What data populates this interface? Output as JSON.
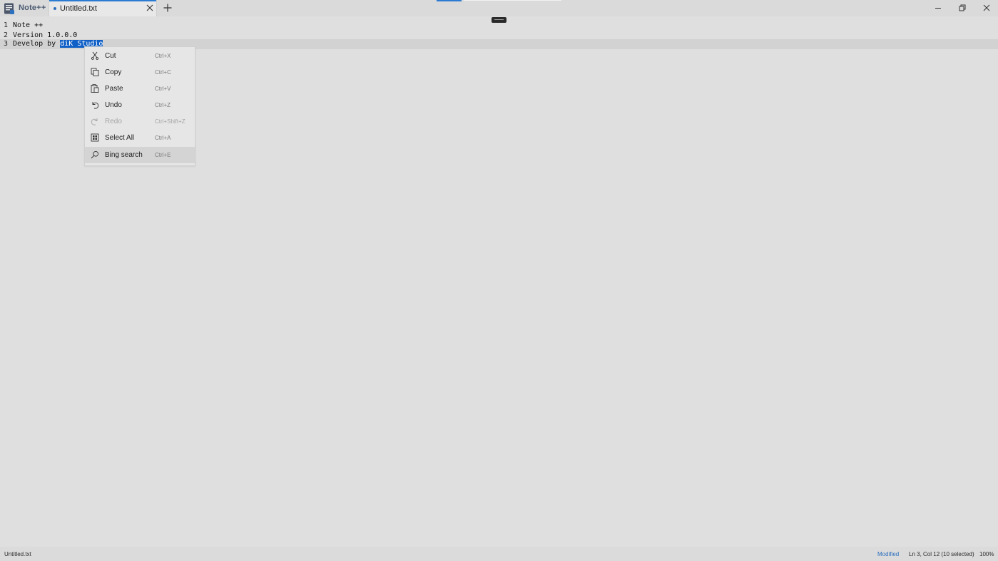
{
  "app": {
    "name": "Note++"
  },
  "tabs": [
    {
      "label": "Untitled.txt",
      "unsaved": true
    }
  ],
  "editor": {
    "lines": [
      {
        "number": "1",
        "text": "Note ++"
      },
      {
        "number": "2",
        "text": "Version 1.0.0.0"
      },
      {
        "number": "3",
        "text_before": "Develop by ",
        "selected": "diK Studio"
      }
    ]
  },
  "context_menu": {
    "items": [
      {
        "label": "Cut",
        "shortcut": "Ctrl+X",
        "icon": "scissors-icon",
        "enabled": true
      },
      {
        "label": "Copy",
        "shortcut": "Ctrl+C",
        "icon": "copy-icon",
        "enabled": true
      },
      {
        "label": "Paste",
        "shortcut": "Ctrl+V",
        "icon": "paste-icon",
        "enabled": true
      },
      {
        "label": "Undo",
        "shortcut": "Ctrl+Z",
        "icon": "undo-icon",
        "enabled": true
      },
      {
        "label": "Redo",
        "shortcut": "Ctrl+Shift+Z",
        "icon": "redo-icon",
        "enabled": false
      },
      {
        "label": "Select All",
        "shortcut": "Ctrl+A",
        "icon": "select-all-icon",
        "enabled": true
      },
      {
        "label": "Bing search",
        "shortcut": "Ctrl+E",
        "icon": "search-icon",
        "enabled": true,
        "highlighted": true
      }
    ]
  },
  "statusbar": {
    "filename": "Untitled.txt",
    "state": "Modified",
    "position": "Ln 3, Col 12 (10 selected)",
    "zoom": "100%"
  },
  "colors": {
    "accent": "#2b7bd3",
    "selection": "#0f5fc6"
  }
}
